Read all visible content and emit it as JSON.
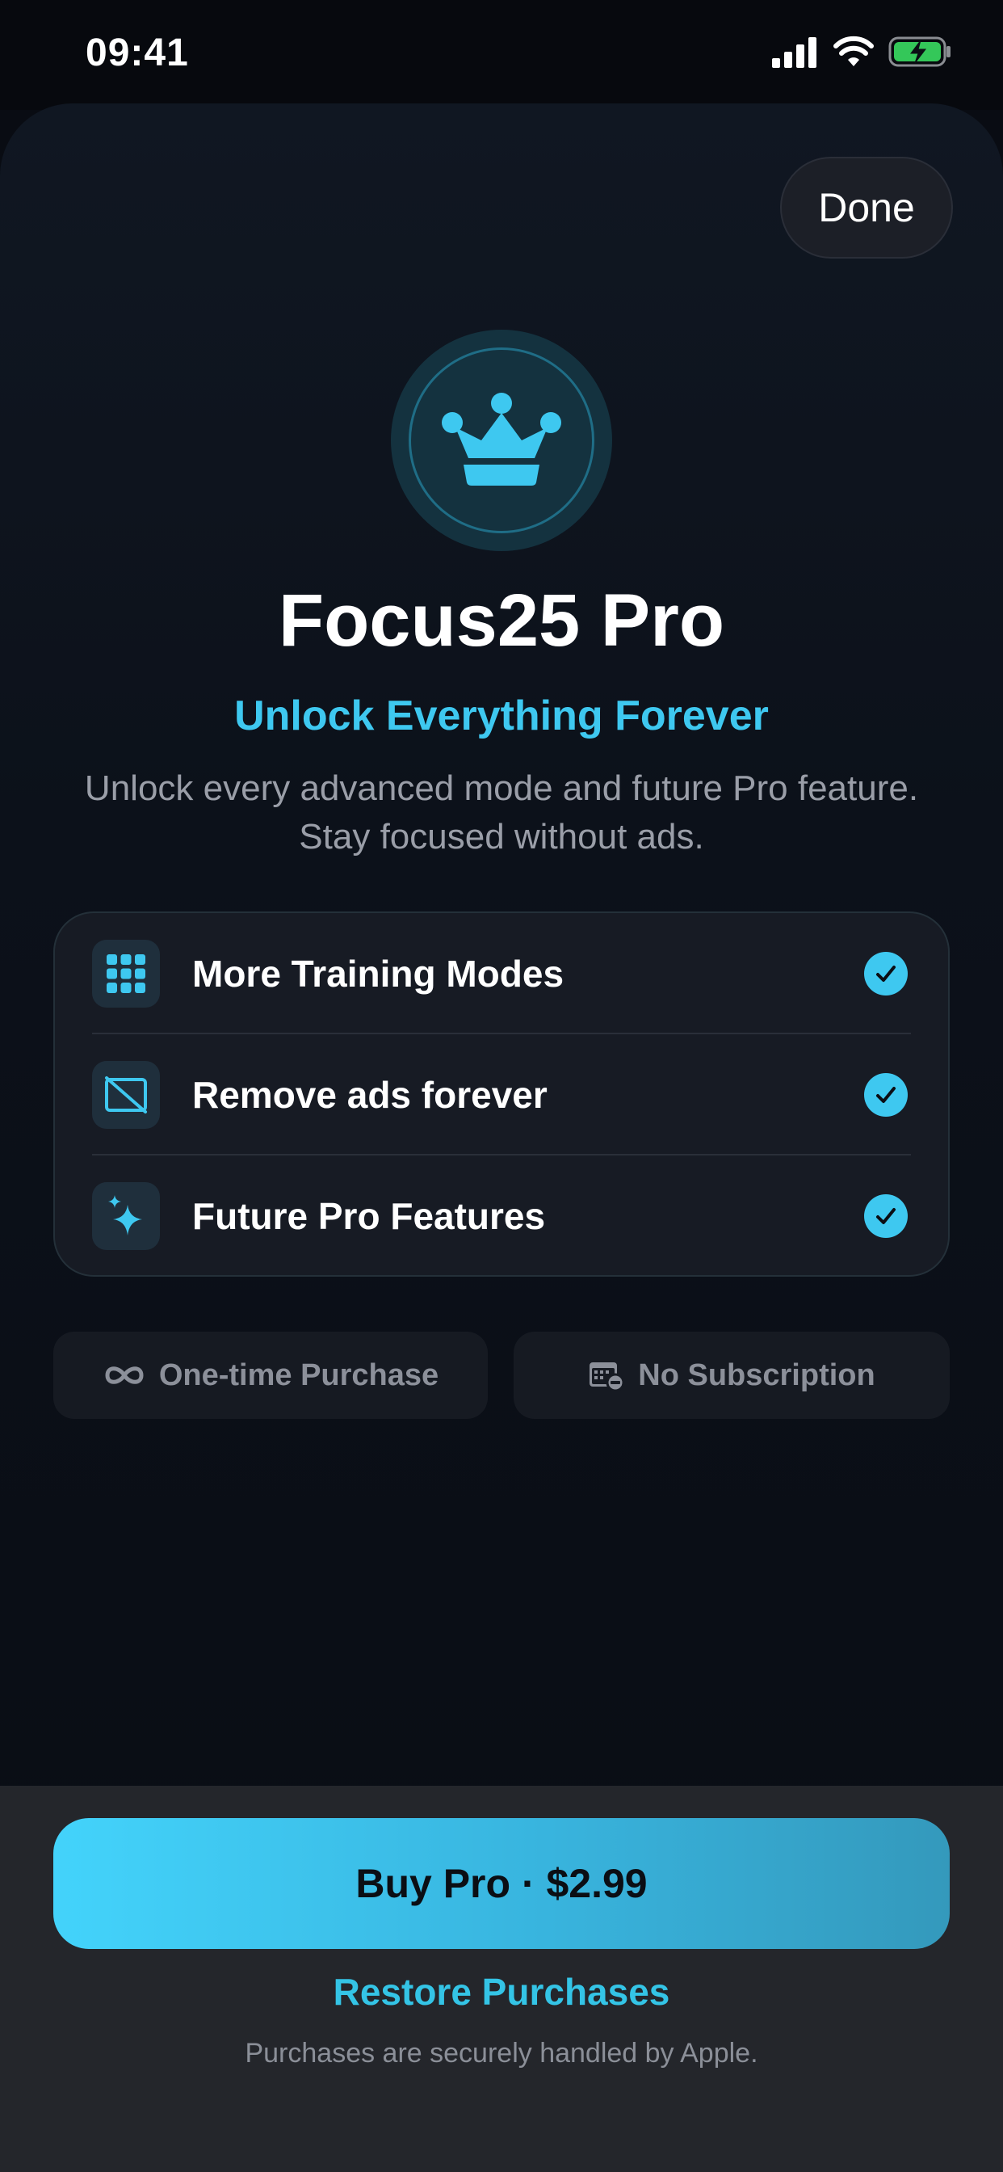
{
  "status_bar": {
    "time": "09:41"
  },
  "header": {
    "done_label": "Done"
  },
  "hero": {
    "icon": "crown-icon",
    "title": "Focus25 Pro",
    "subtitle": "Unlock Everything Forever",
    "description_line1": "Unlock every advanced mode and future Pro feature.",
    "description_line2": "Stay focused without ads."
  },
  "features": [
    {
      "icon": "grid-icon",
      "label": "More Training Modes",
      "checked": true
    },
    {
      "icon": "no-ads-icon",
      "label": "Remove ads forever",
      "checked": true
    },
    {
      "icon": "sparkles-icon",
      "label": "Future Pro Features",
      "checked": true
    }
  ],
  "pills": [
    {
      "icon": "infinity-icon",
      "label": "One-time Purchase"
    },
    {
      "icon": "calendar-minus-icon",
      "label": "No Subscription"
    }
  ],
  "purchase": {
    "buy_label": "Buy Pro · $2.99",
    "restore_label": "Restore Purchases",
    "legal_text": "Purchases are securely handled by Apple."
  },
  "colors": {
    "accent": "#3ec8f0",
    "background": "#090c13",
    "battery_green": "#34c759"
  }
}
